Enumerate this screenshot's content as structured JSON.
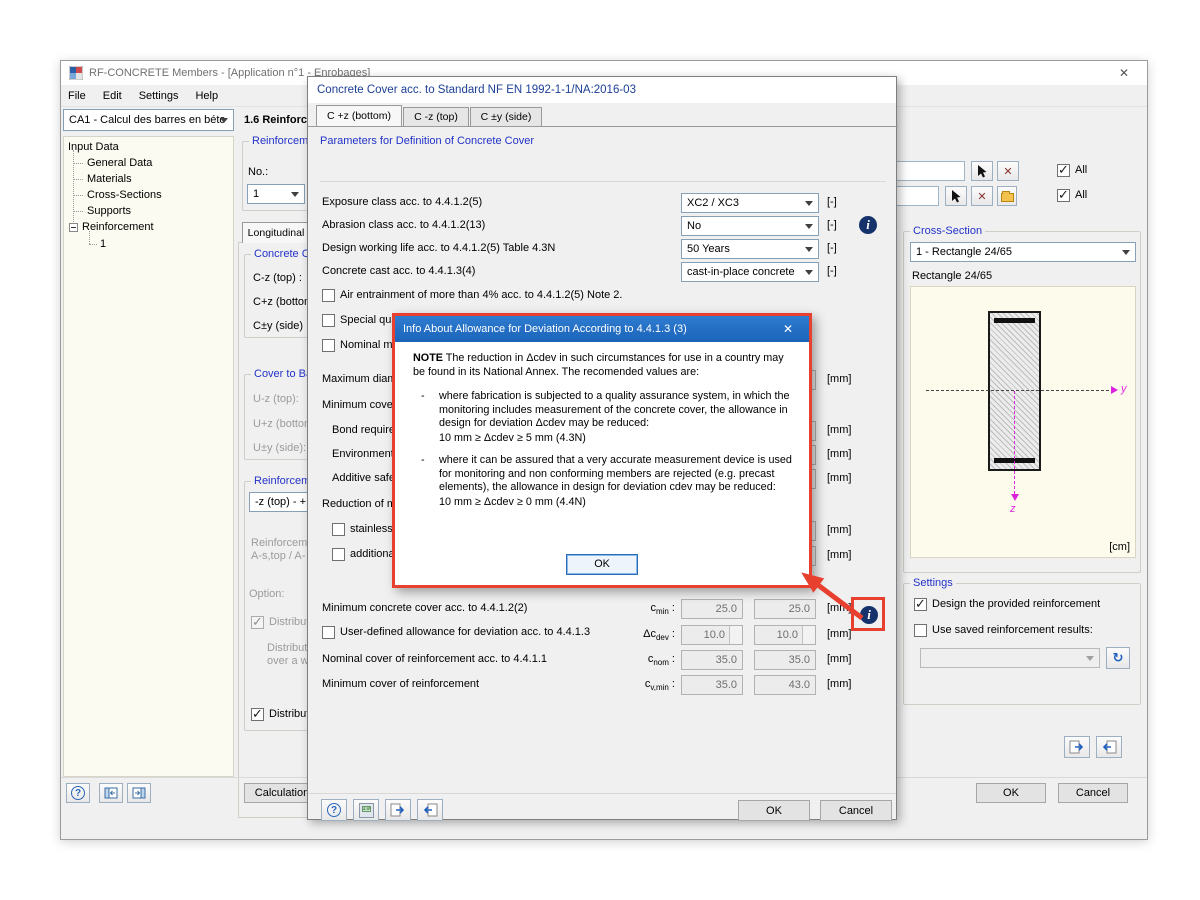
{
  "app": {
    "title": "RF-CONCRETE Members - [Application n°1 - Enrobages]",
    "menu": [
      "File",
      "Edit",
      "Settings",
      "Help"
    ],
    "case_selector": "CA1 - Calcul des barres en béto",
    "tree": {
      "root": "Input Data",
      "items": [
        "General Data",
        "Materials",
        "Cross-Sections",
        "Supports",
        "Reinforcement"
      ],
      "child": "1"
    },
    "panel_header": "1.6 Reinforcer",
    "calculation": "Calculation"
  },
  "strip": {
    "group1_cap": "Reinforceme",
    "no_label": "No.:",
    "no_value": "1",
    "tab": "Longitudinal",
    "concrete_cap": "Concrete Co",
    "c_mz": "C-z (top) :",
    "c_pz": "C+z (bottom)",
    "c_py": "C±y (side) :",
    "cover_cap": "Cover to Ba",
    "u_mz": "U-z (top):",
    "u_pz": "U+z (bottom)",
    "u_py": "U±y (side):",
    "reinf_cap": "Reinforceme",
    "dir_combo": "-z (top) - +",
    "gray1": "Reinforceme",
    "gray2": "A-s,top / A-",
    "option_label": "Option:",
    "cb1": "Distribut",
    "gray3": "Distribut",
    "gray4": "over a w",
    "cb2": "Distribut"
  },
  "right": {
    "filters": [
      {
        "all": "All"
      },
      {
        "all": "All"
      }
    ],
    "cross_section": {
      "caption": "Cross-Section",
      "combo": "1 - Rectangle 24/65",
      "name": "Rectangle 24/65",
      "unit": "[cm]",
      "axis_y": "y",
      "axis_z": "z"
    },
    "settings": {
      "caption": "Settings",
      "design_cb": "Design the provided reinforcement",
      "saved_cb": "Use saved reinforcement results:"
    },
    "ok": "OK",
    "cancel": "Cancel"
  },
  "dialog": {
    "title": "Concrete Cover acc. to Standard NF EN 1992-1-1/NA:2016-03",
    "tabs": [
      "C +z (bottom)",
      "C -z (top)",
      "C ±y (side)"
    ],
    "section": "Parameters for Definition of Concrete Cover",
    "rows": [
      {
        "label": "Exposure class acc. to 4.4.1.2(5)",
        "value": "XC2 / XC3",
        "unit": "[-]"
      },
      {
        "label": "Abrasion class acc. to 4.4.1.2(13)",
        "value": "No",
        "unit": "[-]"
      },
      {
        "label": "Design working life acc. to 4.4.1.2(5) Table 4.3N",
        "value": "50 Years",
        "unit": "[-]"
      },
      {
        "label": "Concrete cast acc. to 4.4.1.3(4)",
        "value": "cast-in-place concrete",
        "unit": "[-]"
      }
    ],
    "checkboxes": [
      "Air entrainment of more than 4% acc. to 4.4.1.2(5) Note 2.",
      "Special quali",
      "Nominal max"
    ],
    "covered_rows": {
      "max_diam": "Maximum diame",
      "min_cover": "Minimum cover",
      "bond": "Bond requirer",
      "env": "Environmenta",
      "additive": "Additive safety",
      "reduction": "Reduction of mi",
      "stainless": "stainless s",
      "additional": "additional",
      "mm": "[mm]"
    },
    "result_rows": [
      {
        "label": "Minimum concrete cover acc. to 4.4.1.2(2)",
        "sym": "c",
        "sub": "min",
        "sep": " :",
        "v1": "25.0",
        "v2": "25.0",
        "unit": "[mm]"
      },
      {
        "label": "User-defined allowance for deviation acc. to 4.4.1.3",
        "sym": "Δc",
        "sub": "dev",
        "sep": " :",
        "v1": "10.0",
        "v2": "10.0",
        "unit": "[mm]"
      },
      {
        "label": "Nominal cover of reinforcement acc. to 4.4.1.1",
        "sym": "c",
        "sub": "nom",
        "sep": " :",
        "v1": "35.0",
        "v2": "35.0",
        "unit": "[mm]"
      },
      {
        "label": "Minimum cover of reinforcement",
        "sym": "c",
        "sub": "v,min",
        "sep": " :",
        "v1": "35.0",
        "v2": "43.0",
        "unit": "[mm]"
      }
    ],
    "calc_icon_label": "0.00",
    "ok": "OK",
    "cancel": "Cancel"
  },
  "popup": {
    "title": "Info About Allowance for Deviation According to 4.4.1.3 (3)",
    "note_lead": "NOTE",
    "note_text": " The reduction in Δcdev in such circumstances for use in a country may be found in its National Annex. The recomended values are:",
    "bullets": [
      {
        "dash": "-",
        "text": "where fabrication is subjected to a quality assurance system, in which the monitoring includes measurement of the concrete cover, the allowance in design for deviation Δcdev may be reduced:",
        "value": "10 mm ≥ Δcdev ≥ 5 mm (4.3N)"
      },
      {
        "dash": "-",
        "text": "where it can be assured that a very accurate measurement device is used for monitoring and non conforming members are rejected (e.g. precast elements), the allowance in design for deviation cdev may be reduced:",
        "value": "10 mm ≥ Δcdev ≥ 0 mm (4.4N)"
      }
    ],
    "ok": "OK"
  }
}
